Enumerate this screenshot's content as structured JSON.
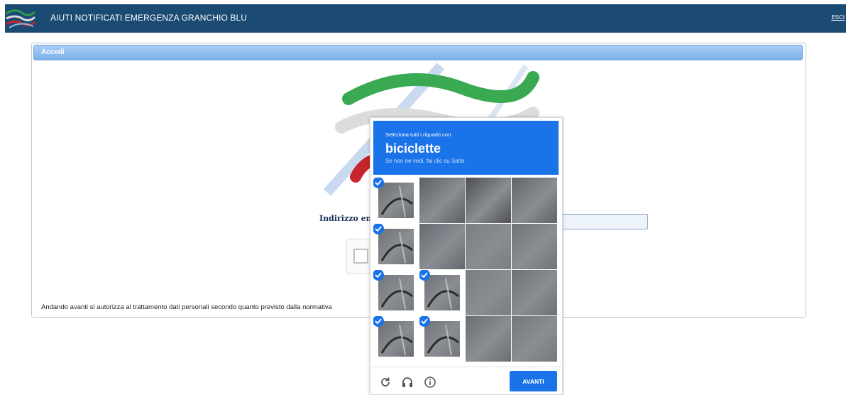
{
  "app": {
    "title": "AIUTI NOTIFICATI EMERGENZA GRANCHIO BLU",
    "exit_link": "ESCI"
  },
  "login": {
    "panel_title": "Accedi",
    "email_label": "Indirizzo email",
    "email_value": "",
    "consent_text": "Andando avanti si autorizza al trattamento dati personali secondo quanto previsto dalla normativa"
  },
  "captcha": {
    "instruction": "Seleziona tutti i riquadri con",
    "target": "biciclette",
    "hint": "Se non ne vedi, fai clic su Salta",
    "next_label": "AVANTI",
    "selected_tiles": [
      [
        0,
        0
      ],
      [
        1,
        0
      ],
      [
        2,
        0
      ],
      [
        2,
        1
      ],
      [
        3,
        0
      ],
      [
        3,
        1
      ]
    ],
    "icons": [
      "reload-icon",
      "audio-headphones-icon",
      "info-icon"
    ]
  },
  "colors": {
    "topbar": "#1b4a73",
    "recaptcha_blue": "#1a73e8",
    "panel_header": "#8dbcef"
  }
}
